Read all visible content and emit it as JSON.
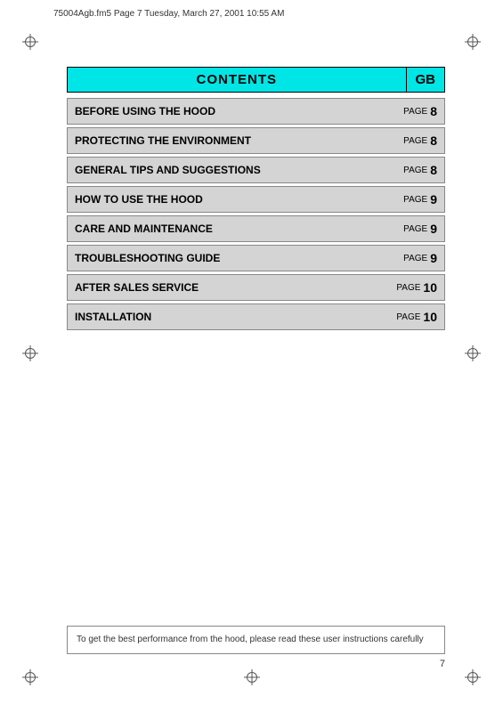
{
  "header": {
    "filename": "75004Agb.fm5  Page 7  Tuesday, March 27, 2001  10:55 AM"
  },
  "contents": {
    "title": "CONTENTS",
    "gb_label": "GB",
    "rows": [
      {
        "id": "before-using",
        "label": "BEFORE USING THE HOOD",
        "page_word": "PAGE",
        "page_num": "8"
      },
      {
        "id": "protecting",
        "label": "PROTECTING THE ENVIRONMENT",
        "page_word": "PAGE",
        "page_num": "8"
      },
      {
        "id": "general-tips",
        "label": "GENERAL TIPS AND SUGGESTIONS",
        "page_word": "PAGE",
        "page_num": "8"
      },
      {
        "id": "how-to-use",
        "label": "HOW TO USE THE HOOD",
        "page_word": "PAGE",
        "page_num": "9"
      },
      {
        "id": "care",
        "label": "CARE AND MAINTENANCE",
        "page_word": "PAGE",
        "page_num": "9"
      },
      {
        "id": "troubleshooting",
        "label": "TROUBLESHOOTING GUIDE",
        "page_word": "PAGE",
        "page_num": "9"
      },
      {
        "id": "after-sales",
        "label": "AFTER SALES SERVICE",
        "page_word": "PAGE",
        "page_num": "10"
      },
      {
        "id": "installation",
        "label": "INSTALLATION",
        "page_word": "PAGE",
        "page_num": "10"
      }
    ]
  },
  "footer": {
    "note": "To get the best performance from the hood, please read these user instructions carefully"
  },
  "page_number": "7"
}
